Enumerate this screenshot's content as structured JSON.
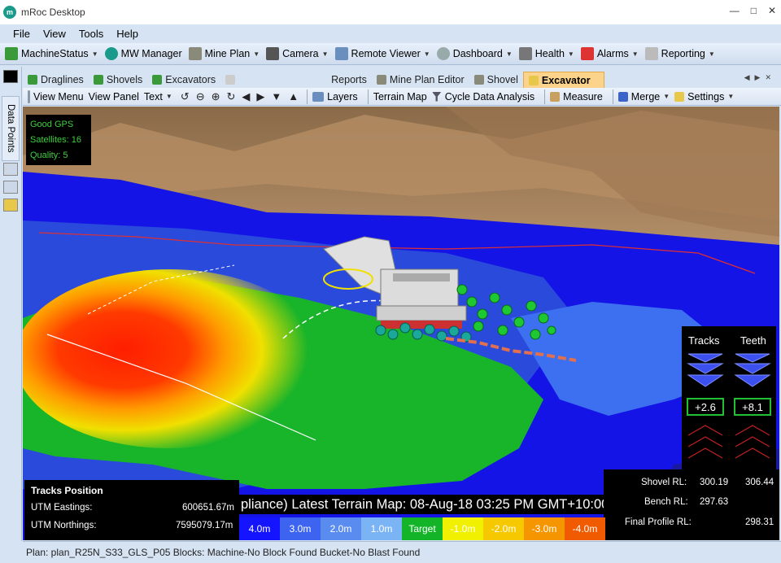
{
  "window": {
    "title": "mRoc Desktop",
    "app_icon": "mroc-logo-icon"
  },
  "menu": [
    "File",
    "View",
    "Tools",
    "Help"
  ],
  "main_toolbar": [
    {
      "label": "MachineStatus",
      "icon": "machine-status-icon",
      "dropdown": true
    },
    {
      "label": "MW Manager",
      "icon": "mw-manager-icon",
      "dropdown": false
    },
    {
      "label": "Mine Plan",
      "icon": "mine-plan-icon",
      "dropdown": true
    },
    {
      "label": "Camera",
      "icon": "camera-icon",
      "dropdown": true
    },
    {
      "label": "Remote Viewer",
      "icon": "remote-viewer-icon",
      "dropdown": true
    },
    {
      "label": "Dashboard",
      "icon": "dashboard-icon",
      "dropdown": true
    },
    {
      "label": "Health",
      "icon": "health-icon",
      "dropdown": true
    },
    {
      "label": "Alarms",
      "icon": "alarms-icon",
      "dropdown": true
    },
    {
      "label": "Reporting",
      "icon": "reporting-icon",
      "dropdown": true
    }
  ],
  "left_panel": {
    "label": "Data Points"
  },
  "tabs": [
    {
      "label": "Draglines",
      "active": false
    },
    {
      "label": "Shovels",
      "active": false
    },
    {
      "label": "Excavators",
      "active": false
    },
    {
      "label": "Reports",
      "active": false
    },
    {
      "label": "Mine Plan Editor",
      "active": false
    },
    {
      "label": "Shovel",
      "active": false
    },
    {
      "label": "Excavator",
      "active": true
    }
  ],
  "view_toolbar": {
    "view_menu": "View Menu",
    "view_panel": "View Panel",
    "text": "Text",
    "layers": "Layers",
    "terrain_map": "Terrain Map",
    "cycle_data": "Cycle Data Analysis",
    "measure": "Measure",
    "merge": "Merge",
    "settings": "Settings"
  },
  "gps": {
    "status": "Good GPS",
    "satellites": "Satellites: 16",
    "quality": "Quality: 5"
  },
  "tracks_teeth": {
    "tracks_label": "Tracks",
    "teeth_label": "Teeth",
    "tracks_value": "+2.6",
    "teeth_value": "+8.1"
  },
  "rl": {
    "shovel_label": "Shovel RL:",
    "shovel_value1": "300.19",
    "shovel_value2": "306.44",
    "bench_label": "Bench RL:",
    "bench_value": "297.63",
    "final_label": "Final Profile RL:",
    "final_value": "298.31"
  },
  "tracks_position": {
    "title": "Tracks Position",
    "eastings_label": "UTM Eastings:",
    "eastings_value": "600651.67m",
    "northings_label": "UTM Northings:",
    "northings_value": "7595079.17m"
  },
  "terrain_caption": "pliance) Latest Terrain Map: 08-Aug-18 03:25 PM GMT+10:00",
  "legend": [
    {
      "label": "4.0m",
      "color": "#1414ff",
      "text_color": "#ffffff"
    },
    {
      "label": "3.0m",
      "color": "#3c64f0",
      "text_color": "#ffffff"
    },
    {
      "label": "2.0m",
      "color": "#5a8cf0",
      "text_color": "#ffffff"
    },
    {
      "label": "1.0m",
      "color": "#7ab4f5",
      "text_color": "#ffffff"
    },
    {
      "label": "Target",
      "color": "#14b428",
      "text_color": "#ffffff"
    },
    {
      "label": "-1.0m",
      "color": "#f0f000",
      "text_color": "#ffffff"
    },
    {
      "label": "-2.0m",
      "color": "#f5c800",
      "text_color": "#ffffff"
    },
    {
      "label": "-3.0m",
      "color": "#f59600",
      "text_color": "#ffffff"
    },
    {
      "label": "-4.0m",
      "color": "#f05a00",
      "text_color": "#ffffff"
    }
  ],
  "status": "Plan: plan_R25N_S33_GLS_P05  Blocks: Machine-No Block Found Bucket-No Blast Found"
}
